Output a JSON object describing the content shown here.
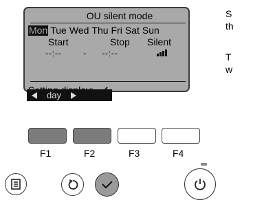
{
  "screen": {
    "title": "OU silent mode",
    "days": [
      {
        "label": "Mon",
        "selected": true
      },
      {
        "label": "Tue",
        "selected": false
      },
      {
        "label": "Wed",
        "selected": false
      },
      {
        "label": "Thu",
        "selected": false
      },
      {
        "label": "Fri",
        "selected": false
      },
      {
        "label": "Sat",
        "selected": false
      },
      {
        "label": "Sun",
        "selected": false
      }
    ],
    "columns": {
      "start_label": "Start",
      "stop_label": "Stop",
      "silent_label": "Silent"
    },
    "values": {
      "start": "--:--",
      "separator": "-",
      "stop": "--:--",
      "silent_icon": "silent-level-icon"
    },
    "setting_display": "Setting display:",
    "setting_icon": "check-icon",
    "nav": {
      "left_icon": "left-arrow-icon",
      "label": "day",
      "right_icon": "right-arrow-icon"
    }
  },
  "function_keys": [
    {
      "label": "F1",
      "shaded": true
    },
    {
      "label": "F2",
      "shaded": true
    },
    {
      "label": "F3",
      "shaded": false
    },
    {
      "label": "F4",
      "shaded": false
    }
  ],
  "buttons": {
    "menu_icon": "menu-icon",
    "return_icon": "return-icon",
    "confirm_icon": "check-icon",
    "power_icon": "power-icon"
  },
  "side_text": [
    "S",
    "th",
    "T",
    "w"
  ]
}
